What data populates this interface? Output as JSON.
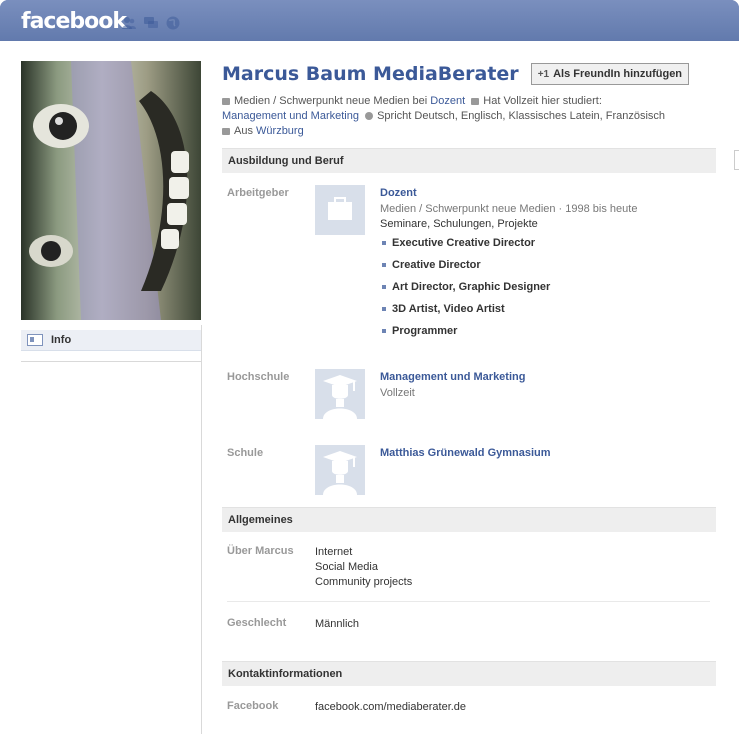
{
  "topbar": {
    "logo": "facebook",
    "jewels": [
      "friend-requests-icon",
      "messages-icon",
      "notifications-globe-icon"
    ]
  },
  "sidebar": {
    "nav_items": [
      {
        "label": "Info",
        "icon": "info-card-icon"
      }
    ]
  },
  "profile": {
    "name": "Marcus Baum MediaBerater",
    "add_friend_label": "Als FreundIn hinzufügen",
    "add_friend_icon_text": "+1",
    "summary": {
      "work_prefix": "Medien / Schwerpunkt neue Medien bei",
      "work_link": "Dozent",
      "study_prefix": "Hat Vollzeit hier studiert:",
      "study_link": "Management und Marketing",
      "languages": "Spricht Deutsch, Englisch, Klassisches Latein, Französisch",
      "from_prefix": "Aus",
      "from_link": "Würzburg"
    }
  },
  "education_work": {
    "heading": "Ausbildung und Beruf",
    "employer": {
      "label": "Arbeitgeber",
      "title": "Dozent",
      "subtitle": "Medien / Schwerpunkt neue Medien · 1998 bis heute",
      "description": "Seminare, Schulungen, Projekte",
      "positions": [
        "Executive Creative Director",
        "Creative Director",
        "Art Director, Graphic Designer",
        "3D Artist, Video Artist",
        "Programmer"
      ]
    },
    "college": {
      "label": "Hochschule",
      "title": "Management und Marketing",
      "subtitle": "Vollzeit"
    },
    "school": {
      "label": "Schule",
      "title": "Matthias Grünewald Gymnasium"
    }
  },
  "general": {
    "heading": "Allgemeines",
    "about_label": "Über Marcus",
    "about_lines": [
      "Internet",
      "Social Media",
      "Community projects"
    ],
    "gender_label": "Geschlecht",
    "gender_value": "Männlich"
  },
  "contact": {
    "heading": "Kontaktinformationen",
    "facebook_label": "Facebook",
    "facebook_value": "facebook.com/mediaberater.de"
  },
  "colors": {
    "brand_blue": "#3b5998",
    "topbar": "#6d84b4",
    "section_bg": "#eeeeee",
    "label_gray": "#999999"
  }
}
